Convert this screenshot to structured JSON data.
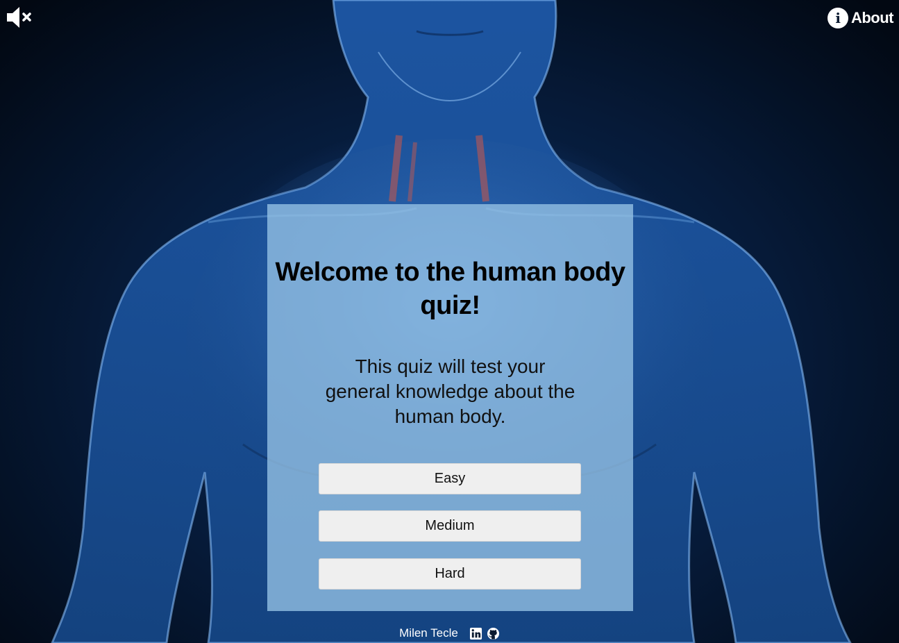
{
  "header": {
    "about_label": "About",
    "info_icon_glyph": "i"
  },
  "card": {
    "title": "Welcome to the human body quiz!",
    "description": "This quiz will test your general knowledge about the human body.",
    "buttons": [
      "Easy",
      "Medium",
      "Hard"
    ]
  },
  "footer": {
    "author": "Milen Tecle"
  },
  "icons": {
    "sound": "mute-icon",
    "info": "info-icon",
    "linkedin": "linkedin-icon",
    "github": "github-icon"
  },
  "colors": {
    "card_background": "#96c3e6",
    "button_background": "#efefef",
    "body_glow": "#2a6fd0"
  }
}
